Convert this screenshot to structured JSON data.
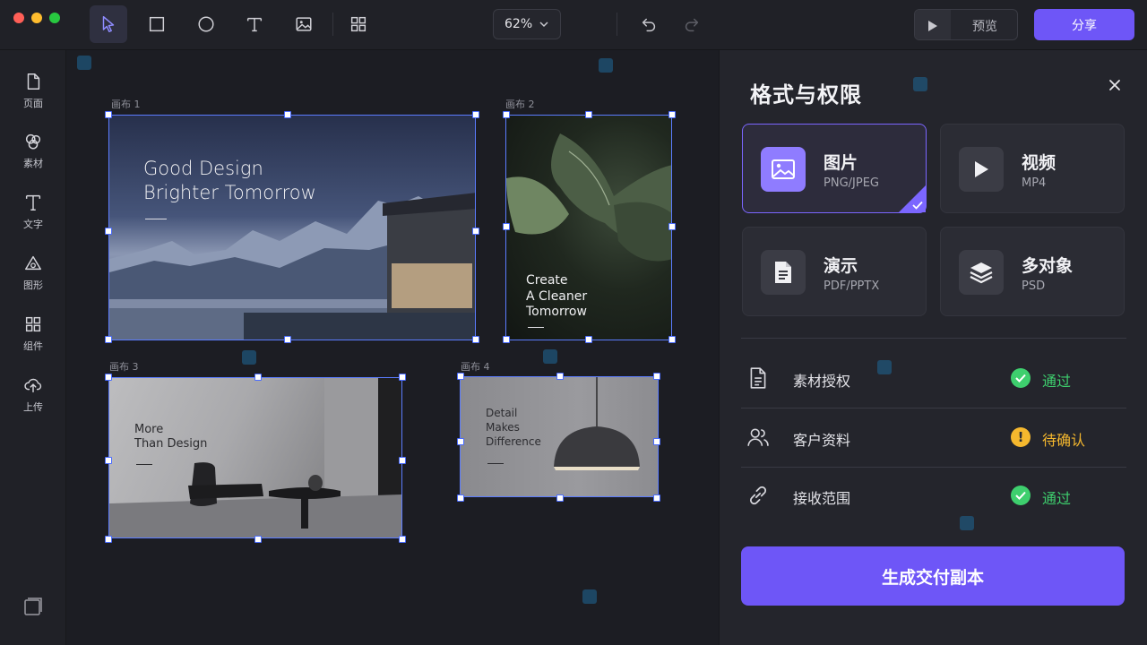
{
  "toolbar": {
    "zoom": "62%",
    "preview_label": "预览",
    "share_label": "分享"
  },
  "sidebar": {
    "items": [
      {
        "label": "页面",
        "icon": "page-icon"
      },
      {
        "label": "素材",
        "icon": "assets-icon"
      },
      {
        "label": "文字",
        "icon": "text-icon"
      },
      {
        "label": "图形",
        "icon": "shapes-icon"
      },
      {
        "label": "组件",
        "icon": "components-icon"
      },
      {
        "label": "上传",
        "icon": "upload-icon"
      }
    ]
  },
  "canvas": {
    "frames": [
      {
        "label": "画布 1",
        "text": "Good Design\nBrighter Tomorrow"
      },
      {
        "label": "画布 2",
        "text": "Create\nA Cleaner\nTomorrow"
      },
      {
        "label": "画布 3",
        "text": "More\nThan Design"
      },
      {
        "label": "画布 4",
        "text": "Detail\nMakes\nDifference"
      }
    ]
  },
  "panel": {
    "title": "格式与权限",
    "formats": [
      {
        "name": "图片",
        "sub": "PNG/JPEG",
        "icon": "image-icon",
        "selected": true
      },
      {
        "name": "视频",
        "sub": "MP4",
        "icon": "play-icon",
        "selected": false
      },
      {
        "name": "演示",
        "sub": "PDF/PPTX",
        "icon": "document-icon",
        "selected": false
      },
      {
        "name": "多对象",
        "sub": "PSD",
        "icon": "layers-icon",
        "selected": false
      }
    ],
    "permissions": [
      {
        "label": "素材授权",
        "status": "通过",
        "state": "ok"
      },
      {
        "label": "客户资料",
        "status": "待确认",
        "state": "pending"
      },
      {
        "label": "接收范围",
        "status": "通过",
        "state": "ok"
      }
    ],
    "generate_label": "生成交付副本"
  },
  "colors": {
    "accent": "#6e56f7",
    "ok": "#3ecf6e",
    "pending": "#f5b82e",
    "selection": "#5b7cff"
  }
}
